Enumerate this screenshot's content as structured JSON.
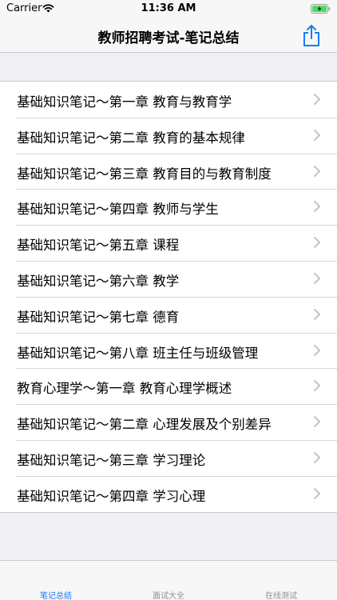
{
  "status_bar": {
    "carrier": "Carrier",
    "time": "11:36 AM"
  },
  "nav": {
    "title": "教师招聘考试-笔记总结",
    "share_icon": "share-icon"
  },
  "list": {
    "items": [
      {
        "label": "基础知识笔记～第一章 教育与教育学"
      },
      {
        "label": "基础知识笔记～第二章 教育的基本规律"
      },
      {
        "label": "基础知识笔记～第三章 教育目的与教育制度"
      },
      {
        "label": "基础知识笔记～第四章 教师与学生"
      },
      {
        "label": "基础知识笔记～第五章 课程"
      },
      {
        "label": "基础知识笔记～第六章 教学"
      },
      {
        "label": "基础知识笔记～第七章 德育"
      },
      {
        "label": "基础知识笔记～第八章 班主任与班级管理"
      },
      {
        "label": "教育心理学～第一章 教育心理学概述"
      },
      {
        "label": "基础知识笔记～第二章 心理发展及个别差异"
      },
      {
        "label": "基础知识笔记～第三章 学习理论"
      },
      {
        "label": "基础知识笔记～第四章 学习心理"
      }
    ]
  },
  "tabs": [
    {
      "label": "笔记总结",
      "active": true
    },
    {
      "label": "面试大全",
      "active": false
    },
    {
      "label": "在线测试",
      "active": false
    }
  ],
  "colors": {
    "accent": "#1a7cf5",
    "inactive_tab": "#8e8e93"
  }
}
